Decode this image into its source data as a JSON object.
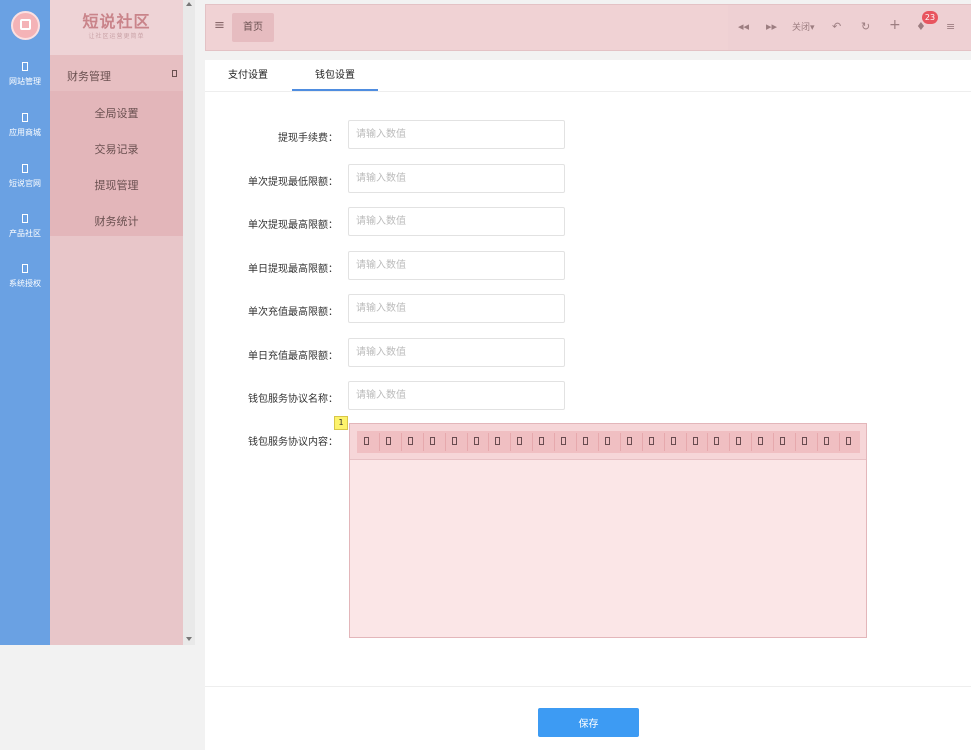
{
  "rail": {
    "items": [
      {
        "label": "网站管理",
        "icon": "box-icon"
      },
      {
        "label": "应用商城",
        "icon": "box-icon"
      },
      {
        "label": "短说官网",
        "icon": "box-icon"
      },
      {
        "label": "产品社区",
        "icon": "box-icon"
      },
      {
        "label": "系统授权",
        "icon": "box-icon"
      }
    ]
  },
  "sidebar": {
    "brand": "短说社区",
    "slogan": "让社区运营更简单",
    "section_title": "财务管理",
    "items": [
      "全局设置",
      "交易记录",
      "提现管理",
      "财务统计"
    ]
  },
  "topbar": {
    "home_tab": "首页",
    "close_label": "关闭▾",
    "notification_count": "23"
  },
  "tabs": [
    "支付设置",
    "钱包设置"
  ],
  "active_tab": 1,
  "form": {
    "placeholder": "请输入数值",
    "fields": [
      "提现手续费：",
      "单次提现最低限额：",
      "单次提现最高限额：",
      "单日提现最高限额：",
      "单次充值最高限额：",
      "单日充值最高限额：",
      "钱包服务协议名称："
    ],
    "editor_label": "钱包服务协议内容：",
    "editor_marker": "1"
  },
  "save_label": "保存",
  "colors": {
    "rail": "#6aa1e3",
    "accent": "#3d9bf3",
    "badge": "#e8555f",
    "sidebar": "#e8c6c9"
  }
}
